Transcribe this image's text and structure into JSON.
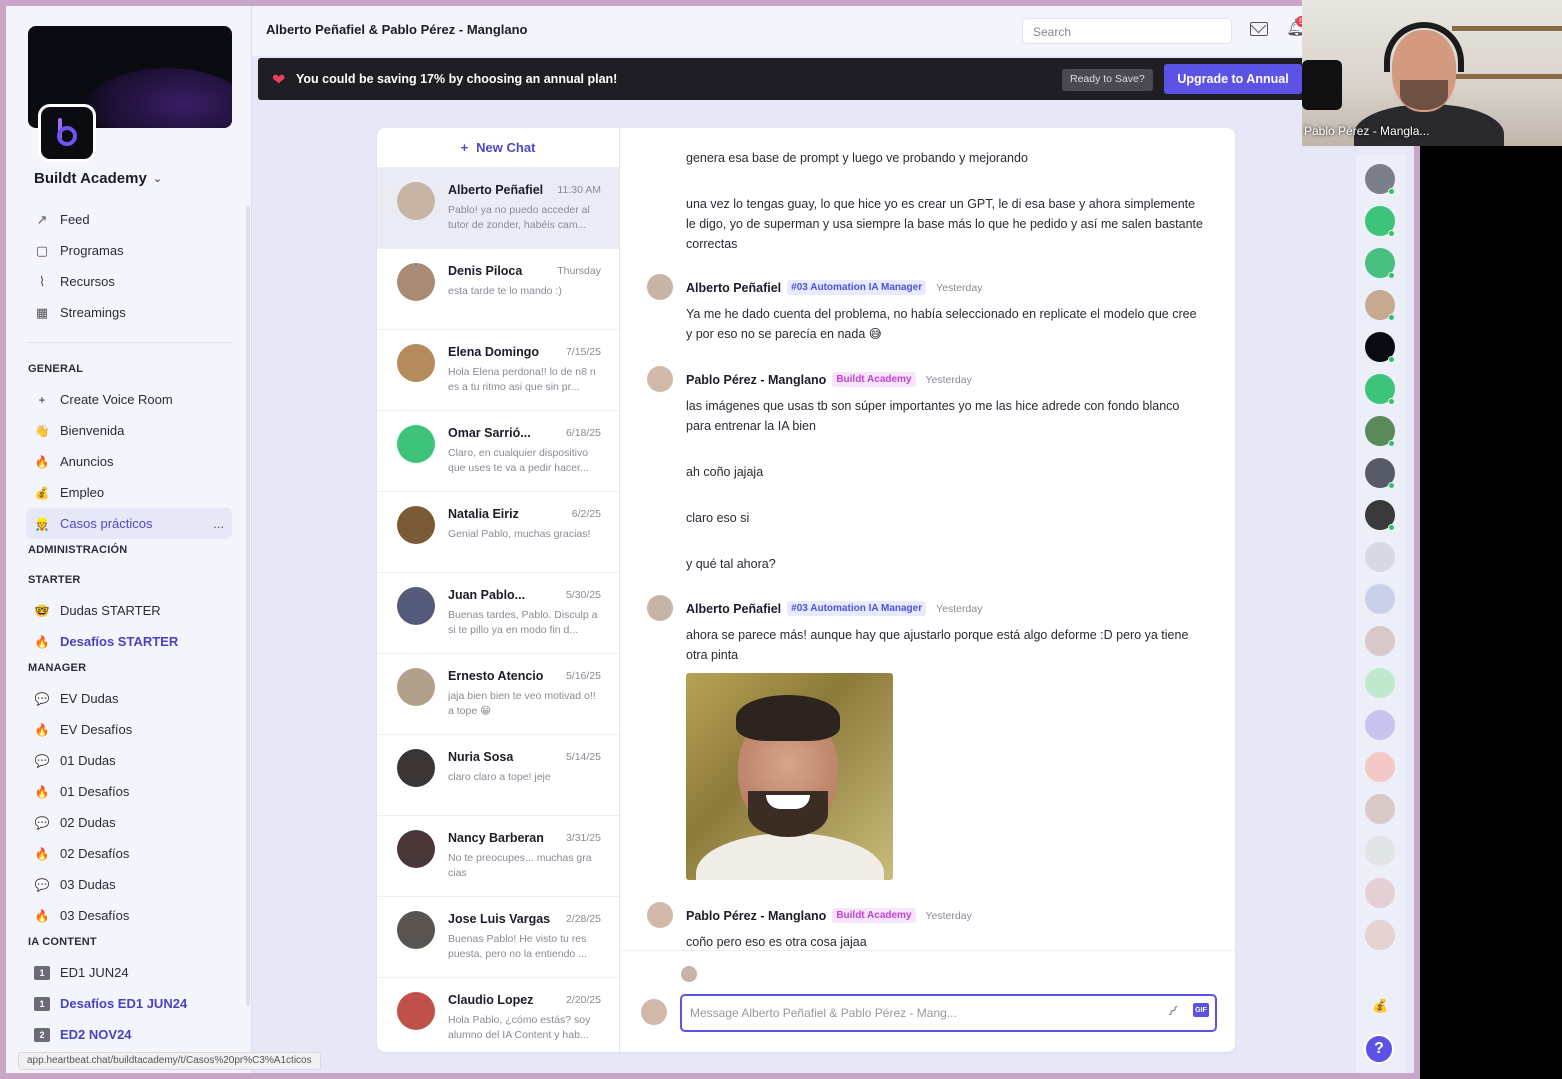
{
  "conversation_title": "Alberto Peñafiel & Pablo Pérez - Manglano",
  "search_placeholder": "Search",
  "notification_badge": "50",
  "promo": {
    "message": "You could be saving 17% by choosing an annual plan!",
    "ready_label": "Ready to Save?",
    "upgrade_label": "Upgrade to Annual"
  },
  "org_name": "Buildt Academy",
  "nav": [
    {
      "label": "Feed",
      "icon": "trend-icon"
    },
    {
      "label": "Programas",
      "icon": "book-icon"
    },
    {
      "label": "Recursos",
      "icon": "paperclip-icon"
    },
    {
      "label": "Streamings",
      "icon": "calendar-icon"
    }
  ],
  "sections": [
    {
      "title": "GENERAL",
      "items": [
        {
          "label": "Create Voice Room",
          "icon": "+"
        },
        {
          "label": "Bienvenida",
          "icon": "👋"
        },
        {
          "label": "Anuncios",
          "icon": "🔥"
        },
        {
          "label": "Empleo",
          "icon": "💰"
        },
        {
          "label": "Casos prácticos",
          "icon": "👷",
          "active": true,
          "more": "..."
        }
      ]
    },
    {
      "title": "ADMINISTRACIÓN",
      "items": []
    },
    {
      "title": "STARTER",
      "items": [
        {
          "label": "Dudas STARTER",
          "icon": "🤓"
        },
        {
          "label": "Desafíos STARTER",
          "icon": "🔥",
          "bold": true
        }
      ]
    },
    {
      "title": "MANAGER",
      "items": [
        {
          "label": "EV Dudas",
          "icon": "💬"
        },
        {
          "label": "EV Desafíos",
          "icon": "🔥"
        },
        {
          "label": "01 Dudas",
          "icon": "💬"
        },
        {
          "label": "01 Desafíos",
          "icon": "🔥"
        },
        {
          "label": "02 Dudas",
          "icon": "💬"
        },
        {
          "label": "02 Desafíos",
          "icon": "🔥"
        },
        {
          "label": "03 Dudas",
          "icon": "💬"
        },
        {
          "label": "03 Desafíos",
          "icon": "🔥"
        }
      ]
    },
    {
      "title": "IA CONTENT",
      "items": [
        {
          "label": "ED1 JUN24",
          "icon": "1"
        },
        {
          "label": "Desafíos ED1 JUN24",
          "icon": "1",
          "bold": true
        },
        {
          "label": "ED2 NOV24",
          "icon": "2",
          "bold": true
        }
      ]
    }
  ],
  "status_url": "app.heartbeat.chat/buildtacademy/t/Casos%20pr%C3%A1cticos",
  "new_chat_label": "New Chat",
  "dms": [
    {
      "name": "Alberto Peñafiel",
      "time": "11:30 AM",
      "preview": "Pablo! ya no puedo acceder al tutor de zonder, habéis cam...",
      "active": true,
      "color": "#c8b4a4"
    },
    {
      "name": "Denis Piloca",
      "time": "Thursday",
      "preview": "esta tarde te lo mando :)",
      "color": "#a98a74"
    },
    {
      "name": "Elena Domingo",
      "time": "7/15/25",
      "preview": "Hola Elena perdona!! lo de n8 n es a tu ritmo asi que sin pr...",
      "color": "#b58a5d"
    },
    {
      "name": "Omar Sarrió...",
      "time": "6/18/25",
      "preview": "Claro, en cualquier dispositivo que uses te va a pedir hacer...",
      "color": "#3ec47a"
    },
    {
      "name": "Natalia Eiriz",
      "time": "6/2/25",
      "preview": "Genial Pablo, muchas gracias!",
      "color": "#7a5b36"
    },
    {
      "name": "Juan Pablo...",
      "time": "5/30/25",
      "preview": "Buenas tardes, Pablo. Disculp a si te pillo ya en modo fin d...",
      "color": "#555a7a"
    },
    {
      "name": "Ernesto Atencio",
      "time": "5/16/25",
      "preview": "jaja bien bien te veo motivad o!! a tope 😁",
      "color": "#b0a08a"
    },
    {
      "name": "Nuria Sosa",
      "time": "5/14/25",
      "preview": "claro claro a tope! jeje",
      "color": "#3a3434"
    },
    {
      "name": "Nancy Barberan",
      "time": "3/31/25",
      "preview": "No te preocupes... muchas gra cias",
      "color": "#4a3838"
    },
    {
      "name": "Jose Luis Vargas",
      "time": "2/28/25",
      "preview": "Buenas Pablo! He visto tu res puesta, pero no la entiendo ...",
      "color": "#5a5450"
    },
    {
      "name": "Claudio Lopez",
      "time": "2/20/25",
      "preview": "Hola Pablo, ¿cómo estás? soy alumno del IA Content y hab...",
      "color": "#c0504a"
    }
  ],
  "thread": {
    "m1_a": "genera esa base de prompt y luego ve probando y mejorando",
    "m1_b": "una vez lo tengas guay, lo que hice yo es crear un GPT, le di esa base y ahora simplemente le digo, yo de superman y usa siempre la base más lo que he pedido y así me salen bastante correctas",
    "m2": {
      "author": "Alberto Peñafiel",
      "tag": "#03 Automation IA Manager",
      "when": "Yesterday",
      "text": "Ya me he dado cuenta del problema, no había seleccionado en replicate el modelo que cree y por eso no se parecía en nada 😅"
    },
    "m3": {
      "author": "Pablo Pérez - Manglano",
      "tag": "Buildt Academy",
      "when": "Yesterday",
      "text": "las imágenes que usas tb son súper importantes yo me las hice adrede con fondo blanco para entrenar la IA bien",
      "text2": "ah coño jajaja",
      "text3": "claro eso si",
      "text4": "y qué tal ahora?"
    },
    "m4": {
      "author": "Alberto Peñafiel",
      "tag": "#03 Automation IA Manager",
      "when": "Yesterday",
      "text": "ahora se parece más! aunque hay que ajustarlo porque está algo deforme :D pero ya tiene otra pinta"
    },
    "m5": {
      "author": "Pablo Pérez - Manglano",
      "tag": "Buildt Academy",
      "when": "Yesterday",
      "text": "coño pero eso es otra cosa jajaa"
    }
  },
  "composer_placeholder": "Message Alberto Peñafiel & Pablo Pérez - Mang...",
  "cam_label": "Pablo Pérez - Mangla...",
  "rail_colors": [
    "#7a7f8a",
    "#3ec47a",
    "#48c082",
    "#c7a890",
    "#0b0b12",
    "#3ec47a",
    "#5a8a5a",
    "#555a66",
    "#3a3a3a",
    "#d8d8e4",
    "#c8d0ea",
    "#d6c8c8",
    "#bfe8cc",
    "#c8c4f0",
    "#f5c8c8",
    "#d8c8c8",
    "#e0e6e8",
    "#e4cfd4",
    "#e6d2d0"
  ]
}
